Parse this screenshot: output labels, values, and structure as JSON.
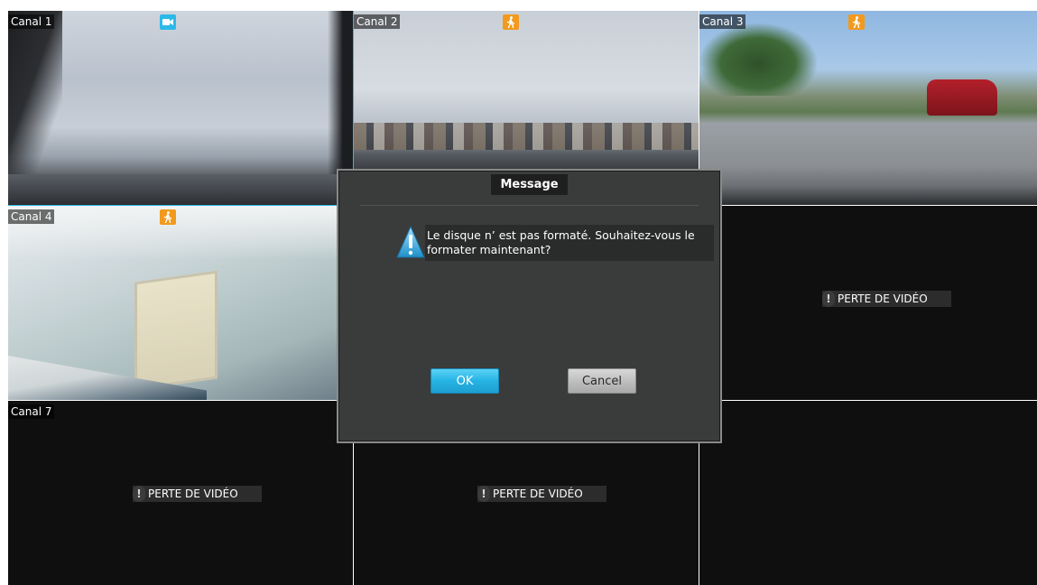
{
  "colors": {
    "selected_border": "#2bb9e8",
    "motion_badge": "#f29a1d",
    "record_badge": "#2bb9e8",
    "no_video_bg": "#0f0f0f",
    "dialog_bg": "#3a3b3b",
    "ok_button": "#25b3e4",
    "cancel_button": "#bfbfbf"
  },
  "channels": [
    {
      "label": "Canal 1",
      "badge": "camera-icon",
      "state": "video",
      "selected": true
    },
    {
      "label": "Canal 2",
      "badge": "walking-person-icon",
      "state": "video"
    },
    {
      "label": "Canal 3",
      "badge": "walking-person-icon",
      "state": "video"
    },
    {
      "label": "Canal 4",
      "badge": "walking-person-icon",
      "state": "video"
    },
    {
      "label": "",
      "state": "hidden-behind-dialog"
    },
    {
      "label": "",
      "state": "video-loss",
      "loss_text": "PERTE DE VIDÉO"
    },
    {
      "label": "Canal 7",
      "state": "video-loss",
      "loss_text": "PERTE DE VIDÉO"
    },
    {
      "label": "",
      "state": "video-loss",
      "loss_text": "PERTE DE VIDÉO"
    },
    {
      "label": "",
      "state": "empty"
    }
  ],
  "dialog": {
    "title": "Message",
    "icon": "info-icon",
    "message": "Le disque n’ est pas formaté. Souhaitez-vous le formater maintenant?",
    "ok_label": "OK",
    "cancel_label": "Cancel"
  }
}
